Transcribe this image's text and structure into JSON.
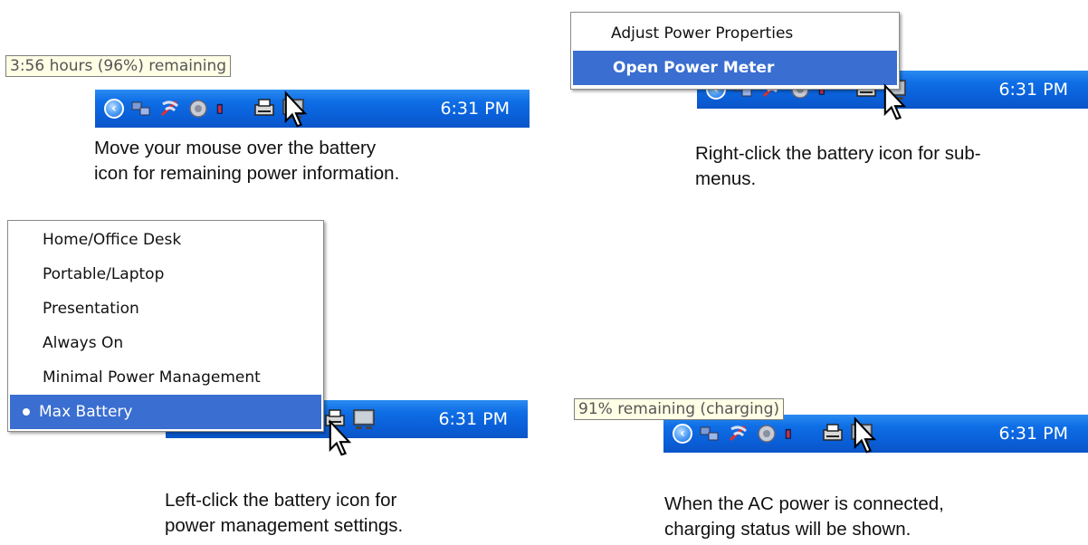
{
  "panels": {
    "hover": {
      "tooltip": "3:56 hours (96%) remaining",
      "clock": "6:31 PM",
      "caption_lines": [
        "Move your mouse over the battery",
        "icon for remaining power information."
      ]
    },
    "right_click": {
      "menu_items": [
        {
          "label": "Adjust Power Properties"
        },
        {
          "label": "Open Power Meter"
        }
      ],
      "clock": "6:31 PM",
      "caption_lines": [
        "Right-click the battery icon for sub-",
        "menus."
      ]
    },
    "left_click": {
      "menu_items": [
        {
          "label": "Home/Office Desk"
        },
        {
          "label": "Portable/Laptop"
        },
        {
          "label": "Presentation"
        },
        {
          "label": "Always On"
        },
        {
          "label": "Minimal Power Management"
        },
        {
          "label": "Max Battery"
        }
      ],
      "selected": "Max Battery",
      "clock": "6:31 PM",
      "caption_lines": [
        "Left-click the battery icon for",
        "power management settings."
      ]
    },
    "charging": {
      "tooltip": "91% remaining (charging)",
      "clock": "6:31 PM",
      "caption_lines": [
        "When the AC power is connected,",
        "charging status will be shown."
      ]
    }
  },
  "icons": [
    "expand-chevron-icon",
    "network-icon",
    "wireless-icon",
    "speaker-icon",
    "battery-icon",
    "printer-icon",
    "display-icon",
    "mouse-pointer-icon"
  ],
  "colors": {
    "taskbar": "#0a5fd8",
    "menu_highlight": "#3a6ed0",
    "tooltip_bg": "#ffffe6"
  }
}
